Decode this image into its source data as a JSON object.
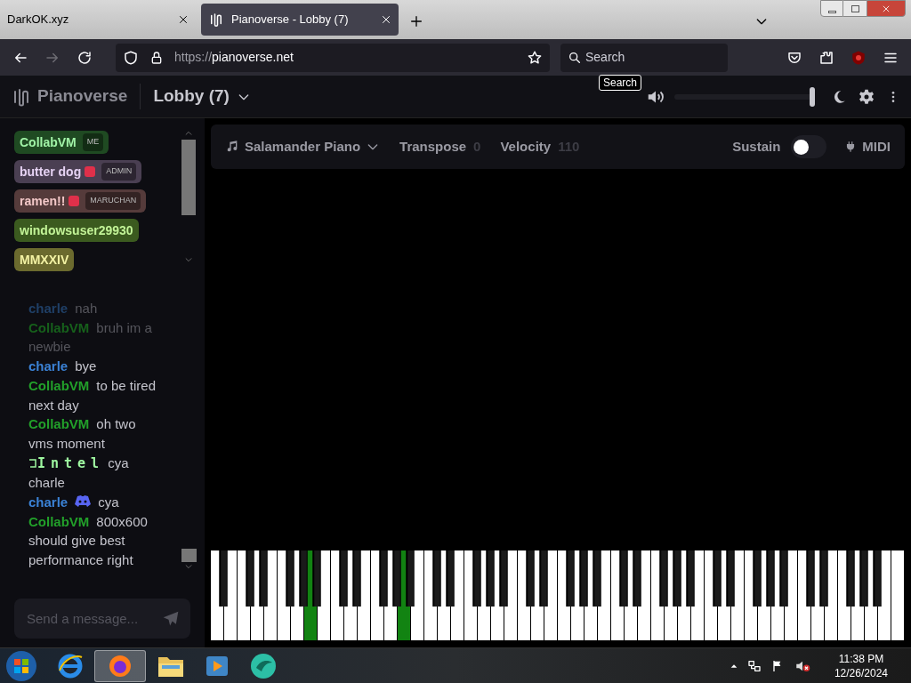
{
  "browser": {
    "tabs": [
      {
        "title": "DarkOK.xyz",
        "selected": false
      },
      {
        "title": "Pianoverse - Lobby (7)",
        "selected": true
      }
    ],
    "url_scheme": "https://",
    "url_host": "pianoverse.net",
    "search_placeholder": "Search",
    "tooltip": "Search"
  },
  "app": {
    "brand": "Pianoverse",
    "room": "Lobby (7)",
    "volume": {
      "level": 1.0
    }
  },
  "users": [
    {
      "name": "CollabVM",
      "tag": "ME",
      "color": "#1f4a22",
      "has_emoji": false
    },
    {
      "name": "butter dog",
      "tag": "ADMIN",
      "color": "#4a3f52",
      "has_emoji": true
    },
    {
      "name": "ramen!!",
      "tag": "MARUCHAN",
      "color": "#553b3b",
      "has_emoji": true
    },
    {
      "name": "windowsuser29930",
      "color": "#3b5a1f",
      "has_emoji": false
    },
    {
      "name": "MMXXIV",
      "color": "#6b6a2e",
      "has_emoji": false
    }
  ],
  "messages": [
    {
      "name": "charle",
      "kind": "plain",
      "color": "#1f3f66",
      "text": "nah",
      "faded": true
    },
    {
      "name": "CollabVM",
      "kind": "plain",
      "color": "#16601b",
      "text": "bruh im a newbie",
      "faded": true
    },
    {
      "name": "charle",
      "kind": "plain",
      "color": "#3b82d6",
      "text": "bye",
      "faded": false
    },
    {
      "name": "CollabVM",
      "kind": "plain",
      "color": "#22a02a",
      "text": "to be tired next day",
      "faded": false
    },
    {
      "name": "CollabVM",
      "kind": "plain",
      "color": "#22a02a",
      "text": "oh two vms moment",
      "faded": false
    },
    {
      "name": "Intel",
      "kind": "mono",
      "color": "#9ef7a0",
      "text": "cya charle",
      "faded": false
    },
    {
      "name": "charle",
      "kind": "badge",
      "color": "#3b82d6",
      "text": "cya",
      "faded": false
    },
    {
      "name": "CollabVM",
      "kind": "plain",
      "color": "#22a02a",
      "text": "800x600 should give best performance right",
      "faded": false
    }
  ],
  "chat_input": {
    "placeholder": "Send a message..."
  },
  "toolbar": {
    "instrument": "Salamander Piano",
    "transpose_label": "Transpose",
    "transpose": "0",
    "velocity_label": "Velocity",
    "velocity": "110",
    "sustain_label": "Sustain",
    "sustain_on": false,
    "midi": "MIDI"
  },
  "piano": {
    "white_keys": [
      {
        "pressed": false
      },
      {
        "pressed": false
      },
      {
        "pressed": false
      },
      {
        "pressed": false
      },
      {
        "pressed": false
      },
      {
        "pressed": false
      },
      {
        "pressed": false
      },
      {
        "pressed": true
      },
      {
        "pressed": false
      },
      {
        "pressed": false
      },
      {
        "pressed": false
      },
      {
        "pressed": false
      },
      {
        "pressed": false
      },
      {
        "pressed": false
      },
      {
        "pressed": true
      },
      {
        "pressed": false
      },
      {
        "pressed": false
      },
      {
        "pressed": false
      },
      {
        "pressed": false
      },
      {
        "pressed": false
      },
      {
        "pressed": false
      },
      {
        "pressed": false
      },
      {
        "pressed": false
      },
      {
        "pressed": false
      },
      {
        "pressed": false
      },
      {
        "pressed": false
      },
      {
        "pressed": false
      },
      {
        "pressed": false
      },
      {
        "pressed": false
      },
      {
        "pressed": false
      },
      {
        "pressed": false
      },
      {
        "pressed": false
      },
      {
        "pressed": false
      },
      {
        "pressed": false
      },
      {
        "pressed": false
      },
      {
        "pressed": false
      },
      {
        "pressed": false
      },
      {
        "pressed": false
      },
      {
        "pressed": false
      },
      {
        "pressed": false
      },
      {
        "pressed": false
      },
      {
        "pressed": false
      },
      {
        "pressed": false
      },
      {
        "pressed": false
      },
      {
        "pressed": false
      },
      {
        "pressed": false
      },
      {
        "pressed": false
      },
      {
        "pressed": false
      },
      {
        "pressed": false
      },
      {
        "pressed": false
      },
      {
        "pressed": false
      },
      {
        "pressed": false
      }
    ]
  },
  "taskbar": {
    "time": "11:38 PM",
    "date": "12/26/2024"
  }
}
